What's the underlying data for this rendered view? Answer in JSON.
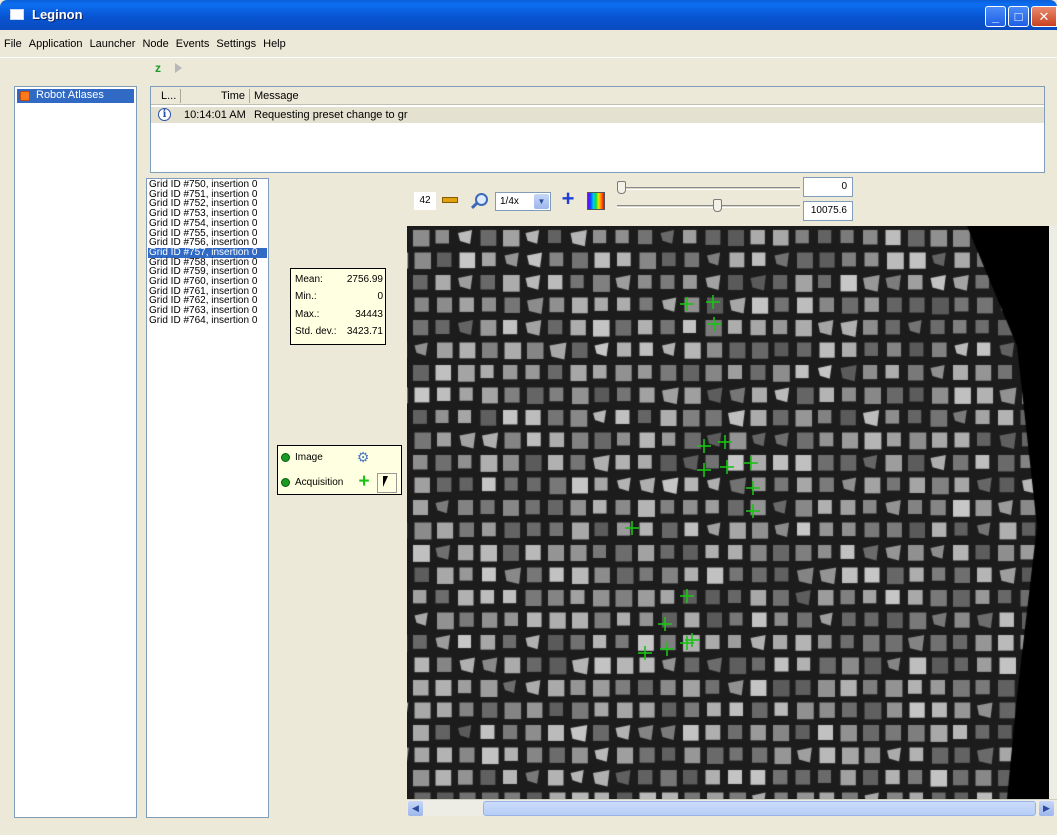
{
  "window": {
    "title": "Leginon"
  },
  "menu": [
    "File",
    "Application",
    "Launcher",
    "Node",
    "Events",
    "Settings",
    "Help"
  ],
  "nodes": [
    {
      "label": "Robot Atlases",
      "selected": true
    }
  ],
  "log": {
    "headers": {
      "level": "L...",
      "time": "Time",
      "message": "Message"
    },
    "rows": [
      {
        "time": "10:14:01 AM",
        "message": "Requesting preset change to gr"
      }
    ]
  },
  "grids": [
    "Grid ID #750, insertion 0",
    "Grid ID #751, insertion 0",
    "Grid ID #752, insertion 0",
    "Grid ID #753, insertion 0",
    "Grid ID #754, insertion 0",
    "Grid ID #755, insertion 0",
    "Grid ID #756, insertion 0",
    "Grid ID #757, insertion 0",
    "Grid ID #758, insertion 0",
    "Grid ID #759, insertion 0",
    "Grid ID #760, insertion 0",
    "Grid ID #761, insertion 0",
    "Grid ID #762, insertion 0",
    "Grid ID #763, insertion 0",
    "Grid ID #764, insertion 0"
  ],
  "selected_grid_index": 7,
  "stats": {
    "mean_label": "Mean:",
    "mean": "2756.99",
    "min_label": "Min.:",
    "min": "0",
    "max_label": "Max.:",
    "max": "34443",
    "std_label": "Std. dev.:",
    "std": "3423.71"
  },
  "targets": {
    "image_label": "Image",
    "acquisition_label": "Acquisition"
  },
  "image_toolbar": {
    "size": "42",
    "zoom": "1/4x",
    "min_value": "0",
    "max_value": "10075.6",
    "min_slider_fraction": 0.0,
    "max_slider_fraction": 0.55
  },
  "colors": {
    "accent": "#316ac5",
    "target_green": "#19c414",
    "panel_bg": "#ffffe1"
  },
  "icons": [
    "app-icon",
    "refresh-icon",
    "play-icon",
    "node-icon",
    "info-icon",
    "ruler-icon",
    "zoom-icon",
    "crosshair-icon",
    "colormap-icon",
    "settings-icon",
    "plus-icon",
    "cursor-icon"
  ]
}
